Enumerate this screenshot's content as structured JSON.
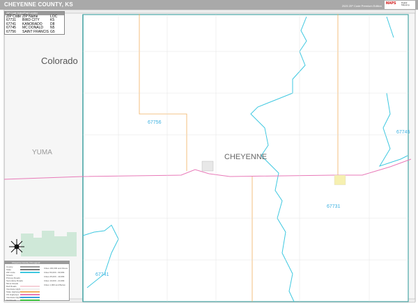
{
  "header": {
    "title": "CHEYENNE COUNTY, KS",
    "edition": "2025 ZIP Code Premium Edition",
    "logo_text": "MARKETMAPS",
    "logo_sub": "Digital Mapping Solutions"
  },
  "zip_table": {
    "title": "ZIP Code Index/Post Locator",
    "columns": [
      "ZIP Code",
      "ZIP Name",
      "LOC"
    ],
    "rows": [
      [
        "67731",
        "BIRD CITY",
        "K5"
      ],
      [
        "67741",
        "KANORADO",
        "D8"
      ],
      [
        "67745",
        "MC DONALD",
        "N5"
      ],
      [
        "67756",
        "SAINT FRANCIS",
        "G5"
      ]
    ]
  },
  "map": {
    "states": [
      "Colorado"
    ],
    "counties": [
      "YUMA",
      "CHEYENNE"
    ],
    "zip_labels": [
      "67756",
      "67745",
      "67731",
      "67741"
    ],
    "colors": {
      "zip_boundary": "#3ec8e0",
      "county_boundary": "#4aa6a6",
      "highway": "#e879b8",
      "road_orange": "#f0b060",
      "public_land": "#cfe8d8",
      "outside": "#f4f4f4"
    }
  },
  "legend": {
    "title": "Cheyenne County, KS Legend",
    "items": [
      "County",
      "State",
      "ZIP Code",
      "Streets",
      "Primary Roads",
      "Secondary Roads",
      "Minor Roads",
      "Rail Roads",
      "Interstate Highways",
      "State Highways",
      "US Highways",
      "Interstate Highways",
      "Toll Roads"
    ],
    "city_sizes": [
      "Cities 100,000 and Above",
      "Cities 50,000 - 99,999",
      "Cities 25,000 - 49,999",
      "Cities 10,000 - 24,999",
      "Cities 1,000 and Below"
    ]
  }
}
